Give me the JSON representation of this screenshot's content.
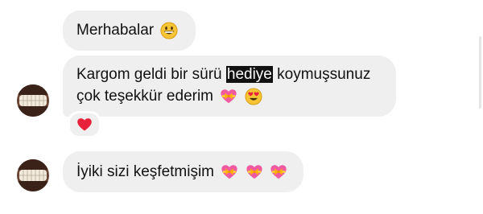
{
  "messages": [
    {
      "id": "m1",
      "text": "Merhabalar",
      "emojis": [
        "grinning-face"
      ]
    },
    {
      "id": "m2",
      "line1_before": "Kargom geldi bir sürü ",
      "line1_highlight": "hediye",
      "line1_after": " koymuşsunuz",
      "line2": "çok teşekkür ederim",
      "emojis": [
        "heart-with-ribbon",
        "heart-eyes-face"
      ],
      "reaction": "red-heart"
    },
    {
      "id": "m3",
      "text": "İyiki sizi keşfetmişim",
      "emojis": [
        "heart-with-ribbon",
        "heart-with-ribbon",
        "heart-with-ribbon"
      ]
    }
  ],
  "colors": {
    "bubble": "#efefef",
    "highlight_bg": "#111111",
    "highlight_fg": "#ffffff",
    "heart": "#e8223a",
    "emoji_yellow": "#f7c436"
  }
}
